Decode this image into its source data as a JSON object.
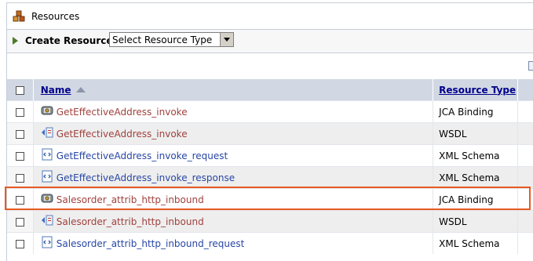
{
  "header": {
    "title": "Resources",
    "icon": "resources-icon"
  },
  "create": {
    "label": "Create Resource:",
    "select_value": "Select Resource Type"
  },
  "table": {
    "columns": {
      "name": "Name",
      "type": "Resource Type"
    },
    "rows": [
      {
        "name": "GetEffectiveAddress_invoke",
        "type": "JCA Binding",
        "icon": "jca-binding-icon",
        "link_color": "red",
        "shaded": false
      },
      {
        "name": "GetEffectiveAddress_invoke",
        "type": "WSDL",
        "icon": "wsdl-icon",
        "link_color": "red",
        "shaded": true
      },
      {
        "name": "GetEffectiveAddress_invoke_request",
        "type": "XML Schema",
        "icon": "xml-schema-icon",
        "link_color": "blue",
        "shaded": false
      },
      {
        "name": "GetEffectiveAddress_invoke_response",
        "type": "XML Schema",
        "icon": "xml-schema-icon",
        "link_color": "blue",
        "shaded": true
      },
      {
        "name": "Salesorder_attrib_http_inbound",
        "type": "JCA Binding",
        "icon": "jca-binding-icon",
        "link_color": "red",
        "shaded": false
      },
      {
        "name": "Salesorder_attrib_http_inbound",
        "type": "WSDL",
        "icon": "wsdl-icon",
        "link_color": "red",
        "shaded": true
      },
      {
        "name": "Salesorder_attrib_http_inbound_request",
        "type": "XML Schema",
        "icon": "xml-schema-icon",
        "link_color": "blue",
        "shaded": false
      }
    ]
  },
  "highlight_color": "#e85a22"
}
